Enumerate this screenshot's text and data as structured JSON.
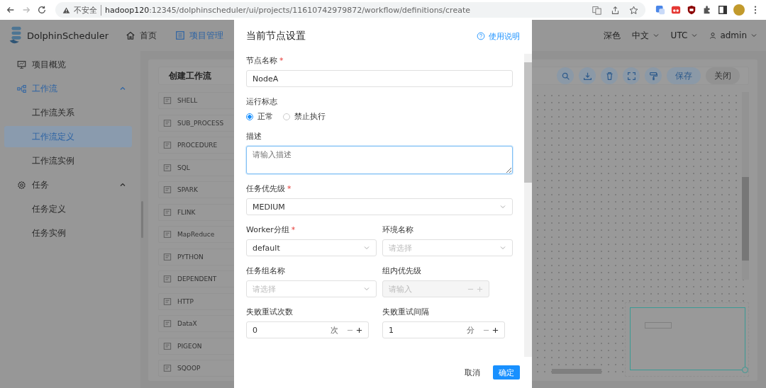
{
  "browser": {
    "security_label": "不安全",
    "url_host": "hadoop120",
    "url_path": ":12345/dolphinscheduler/ui/projects/11610742979872/workflow/definitions/create"
  },
  "header": {
    "brand": "DolphinScheduler",
    "nav": [
      {
        "label": "首页",
        "selected": false
      },
      {
        "label": "项目管理",
        "selected": true
      }
    ],
    "theme": "深色",
    "language": "中文",
    "timezone": "UTC",
    "user": "admin"
  },
  "sidebar": {
    "items": [
      {
        "label": "项目概览",
        "selected": false
      },
      {
        "label": "工作流",
        "expanded": true,
        "selected": true,
        "children": [
          {
            "label": "工作流关系",
            "selected": false
          },
          {
            "label": "工作流定义",
            "selected": true
          },
          {
            "label": "工作流实例",
            "selected": false
          }
        ]
      },
      {
        "label": "任务",
        "expanded": true,
        "selected": false,
        "children": [
          {
            "label": "任务定义",
            "selected": false
          },
          {
            "label": "任务实例",
            "selected": false
          }
        ]
      }
    ]
  },
  "workflow": {
    "title": "创建工作流",
    "save": "保存",
    "close": "关闭",
    "tasks": [
      "SHELL",
      "SUB_PROCESS",
      "PROCEDURE",
      "SQL",
      "SPARK",
      "FLINK",
      "MapReduce",
      "PYTHON",
      "DEPENDENT",
      "HTTP",
      "DataX",
      "PIGEON",
      "SQOOP"
    ]
  },
  "drawer": {
    "title": "当前节点设置",
    "help": "使用说明",
    "cancel": "取消",
    "confirm": "确定",
    "rows": [
      [
        {
          "kind": "text",
          "label": "节点名称",
          "required_mark": "*",
          "value": "NodeA"
        }
      ],
      [
        {
          "kind": "radio",
          "label": "运行标志",
          "options": [
            {
              "label": "正常",
              "selected": true
            },
            {
              "label": "禁止执行",
              "selected": false
            }
          ]
        }
      ],
      [
        {
          "kind": "textarea",
          "label": "描述",
          "placeholder": "请输入描述",
          "focused": true
        }
      ],
      [
        {
          "kind": "select",
          "label": "任务优先级",
          "required_mark": "*",
          "value": "MEDIUM"
        }
      ],
      [
        {
          "kind": "select",
          "label": "Worker分组",
          "required_mark": "*",
          "value": "default"
        },
        {
          "kind": "select",
          "label": "环境名称",
          "placeholder": "请选择"
        }
      ],
      [
        {
          "kind": "select",
          "label": "任务组名称",
          "placeholder": "请选择"
        },
        {
          "kind": "number",
          "label": "组内优先级",
          "placeholder": "请输入",
          "disabled": true
        }
      ],
      [
        {
          "kind": "number",
          "label": "失败重试次数",
          "value": "0",
          "unit": "次",
          "disabled": false
        },
        {
          "kind": "number",
          "label": "失败重试间隔",
          "value": "1",
          "unit": "分",
          "disabled": false
        }
      ]
    ]
  }
}
